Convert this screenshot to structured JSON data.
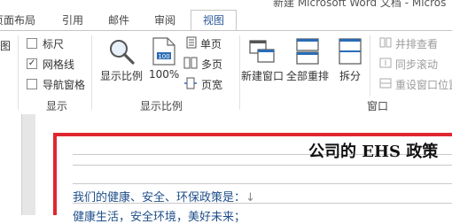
{
  "window": {
    "title_partial": "新建 Microsoft Word 文档 - Micros"
  },
  "tabs": [
    {
      "label": "页面布局"
    },
    {
      "label": "引用"
    },
    {
      "label": "邮件"
    },
    {
      "label": "审阅"
    },
    {
      "label": "视图",
      "active": true
    }
  ],
  "ribbon": {
    "show_group": {
      "label": "显示",
      "left_cut_label": "图",
      "checkboxes": [
        {
          "label": "标尺",
          "checked": false
        },
        {
          "label": "网格线",
          "checked": true
        },
        {
          "label": "导航窗格",
          "checked": false
        }
      ]
    },
    "zoom_group": {
      "label": "显示比例",
      "zoom_button": "显示比例",
      "percent_button": "100%",
      "percent_icon_text": "100",
      "small_buttons": [
        "单页",
        "多页",
        "页宽"
      ]
    },
    "window_group": {
      "label": "窗口",
      "new_window": "新建窗口",
      "arrange_all": "全部重排",
      "split": "拆分",
      "disabled_buttons": [
        "并排查看",
        "同步滚动",
        "重设窗口位置"
      ]
    }
  },
  "document": {
    "title": "公司的 EHS 政策",
    "line1": "我们的健康、安全、环保政策是：",
    "line2": "健康生活，安全环境，美好未来；",
    "para_mark": "↓"
  },
  "colors": {
    "accent": "#2b579a",
    "frame": "#e0262f",
    "doc_text": "#1f4e8a"
  }
}
